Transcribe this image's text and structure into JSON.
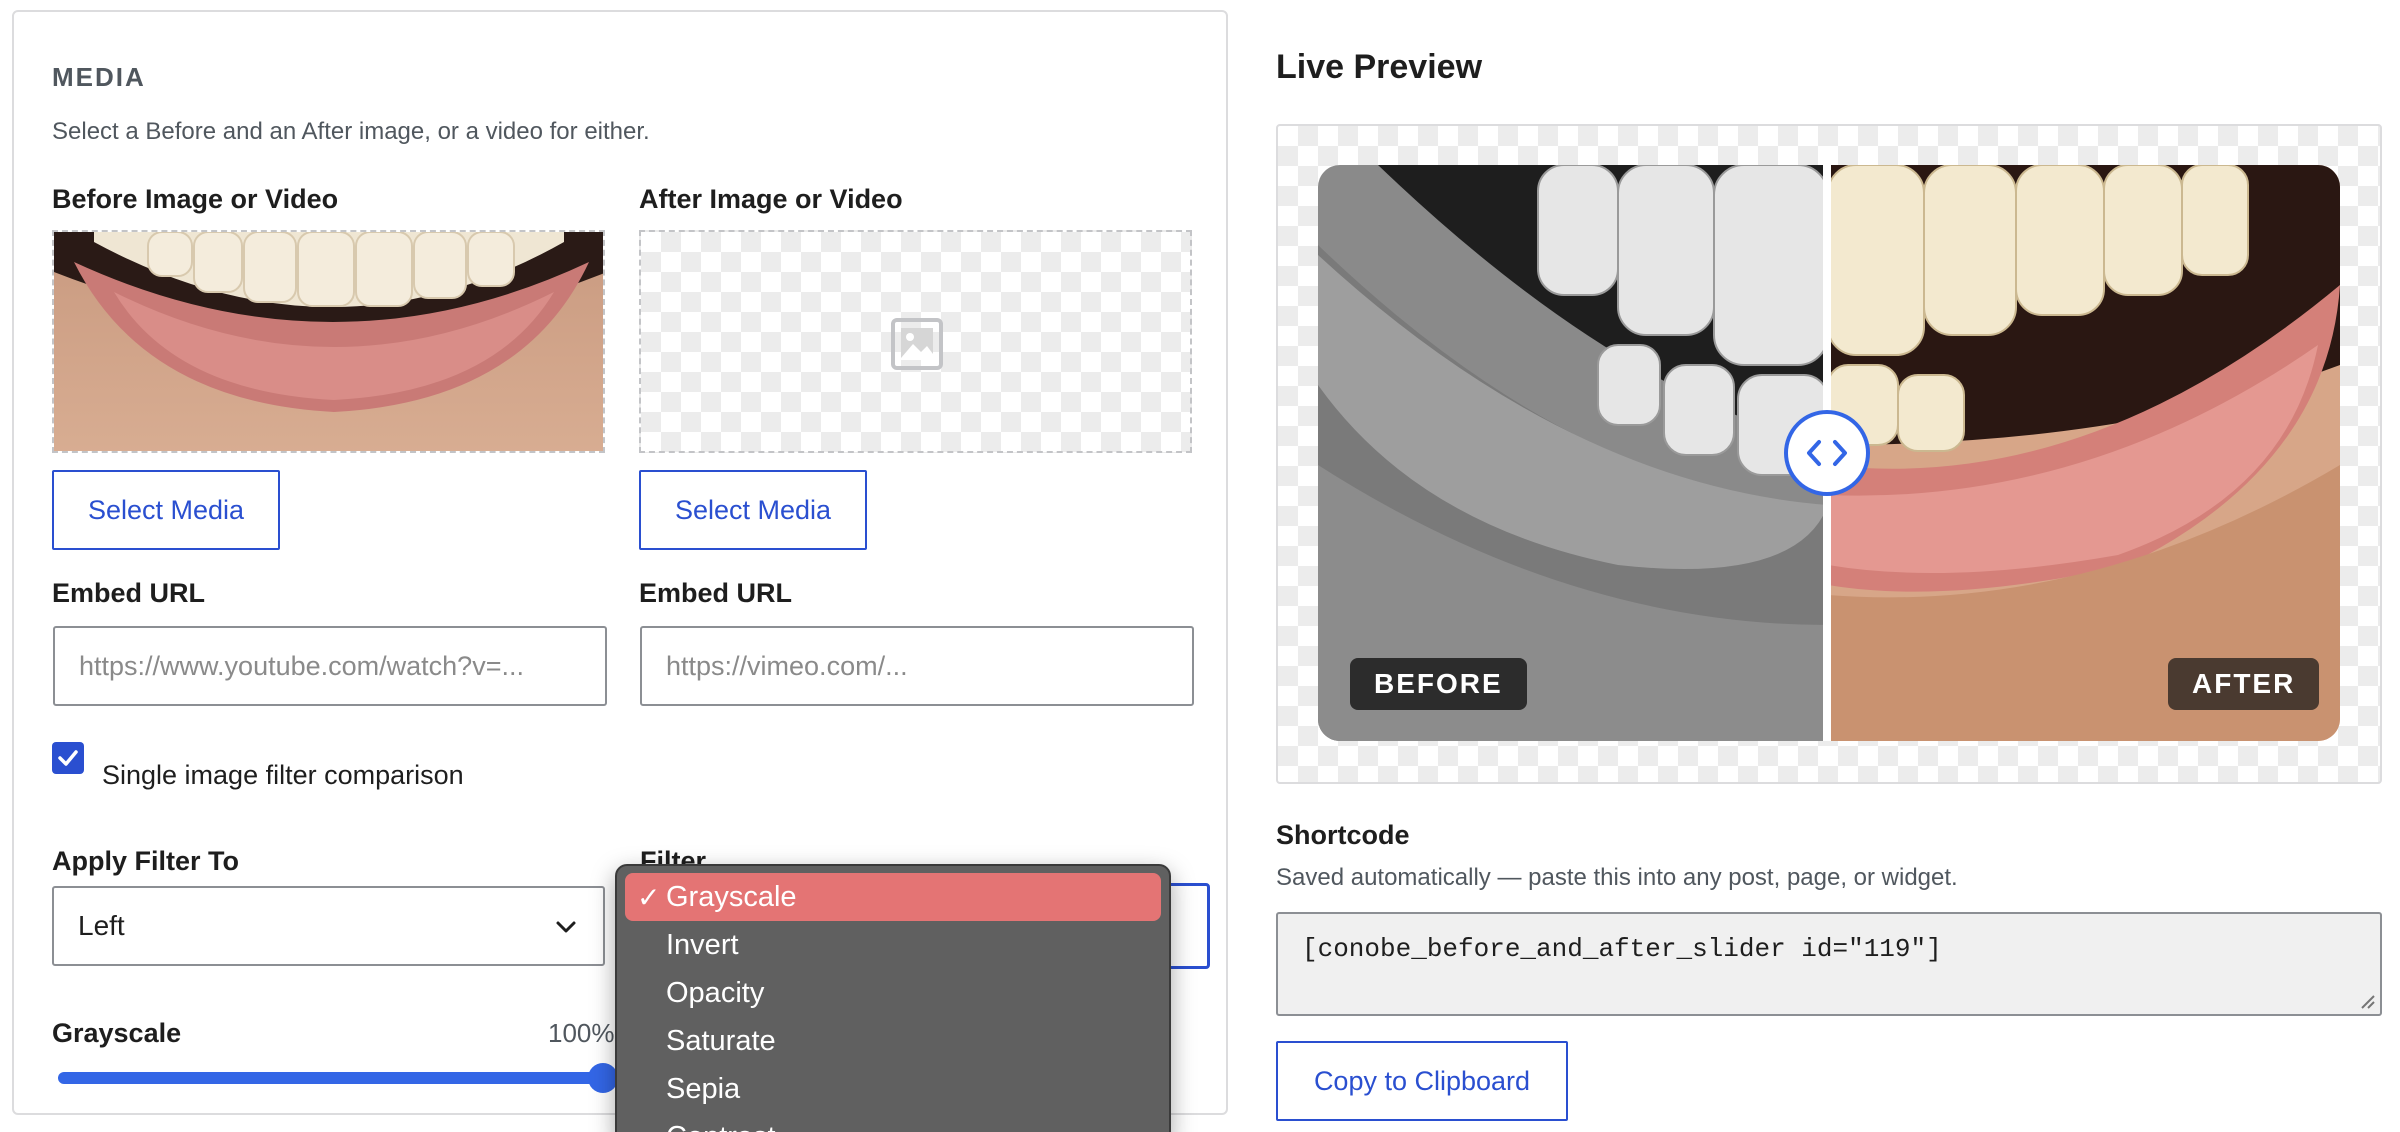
{
  "media": {
    "heading": "MEDIA",
    "description": "Select a Before and an After image, or a video for either.",
    "before": {
      "label": "Before Image or Video",
      "select_button": "Select Media",
      "embed_label": "Embed URL",
      "embed_placeholder": "https://www.youtube.com/watch?v=..."
    },
    "after": {
      "label": "After Image or Video",
      "select_button": "Select Media",
      "embed_label": "Embed URL",
      "embed_placeholder": "https://vimeo.com/...",
      "placeholder_icon": "image-placeholder-icon"
    },
    "single_filter": {
      "checked": true,
      "label": "Single image filter comparison"
    },
    "apply_filter": {
      "label": "Apply Filter To",
      "value": "Left"
    },
    "filter": {
      "label": "Filter",
      "options": [
        "Grayscale",
        "Invert",
        "Opacity",
        "Saturate",
        "Sepia",
        "Contrast"
      ],
      "selected": "Grayscale",
      "check_mark": "✓"
    },
    "intensity": {
      "label": "Grayscale",
      "value": "100%",
      "level": 1.0
    }
  },
  "preview": {
    "title": "Live Preview",
    "before_badge": "BEFORE",
    "after_badge": "AFTER",
    "divider_position": 0.5
  },
  "shortcode": {
    "label": "Shortcode",
    "description": "Saved automatically — paste this into any post, page, or widget.",
    "value": "[conobe_before_and_after_slider id=\"119\"]",
    "copy_button": "Copy to Clipboard"
  },
  "colors": {
    "accent": "#2a4fd0",
    "slider": "#3366e6",
    "dropdown_bg": "#606060",
    "dropdown_selected": "#e47474"
  }
}
